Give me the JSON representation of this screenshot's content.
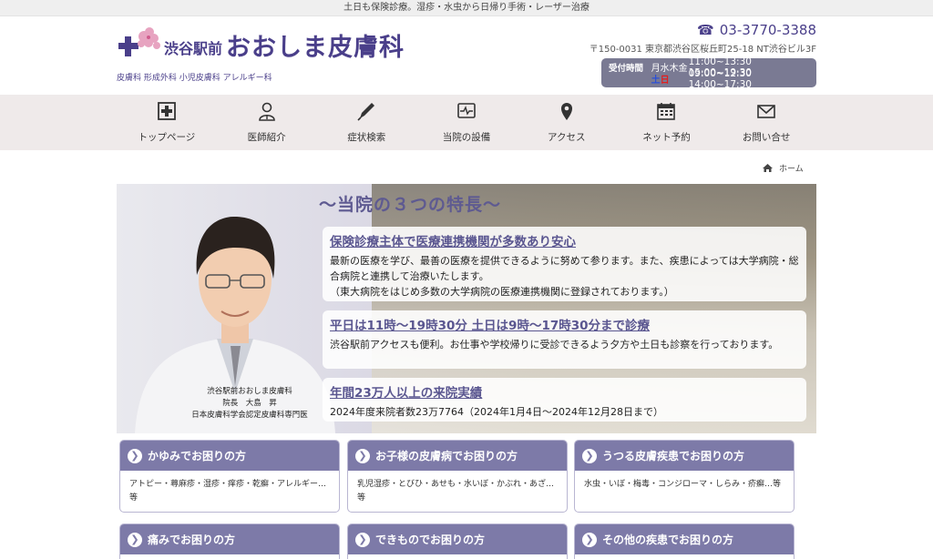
{
  "topbar": {
    "text": "土日も保険診療。湿疹・水虫から日帰り手術・レーザー治療"
  },
  "header": {
    "logo_prefix": "渋谷駅前",
    "logo_name": "おおしま皮膚科",
    "logo_subtitle": "皮膚科 形成外科 小児皮膚科 アレルギー科",
    "phone": "03-3770-3388",
    "address": "〒150-0031 東京都渋谷区桜丘町25-18 NT渋谷ビル3F",
    "hours": {
      "label": "受付時間",
      "weekdays": "月水木金",
      "weekday_times": "11:00~13:30 15:00~19:30",
      "sat": "土",
      "sun": "日",
      "weekend_times": "09:00~12:30 14:00~17:30"
    }
  },
  "nav": [
    {
      "label": "トップページ",
      "icon": "home-icon"
    },
    {
      "label": "医師紹介",
      "icon": "doctor-icon"
    },
    {
      "label": "症状検索",
      "icon": "pen-icon"
    },
    {
      "label": "当院の設備",
      "icon": "monitor-icon"
    },
    {
      "label": "アクセス",
      "icon": "map-pin-icon"
    },
    {
      "label": "ネット予約",
      "icon": "calendar-icon"
    },
    {
      "label": "お問い合せ",
      "icon": "mail-icon"
    }
  ],
  "breadcrumb": {
    "home": "ホーム"
  },
  "hero": {
    "title": "～当院の３つの特長～",
    "caption_line1": "渋谷駅前おおしま皮膚科",
    "caption_line2": "院長　大島　昇",
    "caption_line3": "日本皮膚科学会認定皮膚科専門医",
    "features": [
      {
        "title": "保険診療主体で医療連携機関が多数あり安心",
        "text": "最新の医療を学び、最善の医療を提供できるように努めて参ります。また、疾患によっては大学病院・総合病院と連携して治療いたします。\n（東大病院をはじめ多数の大学病院の医療連携機関に登録されております。）"
      },
      {
        "title": "平日は11時〜19時30分 土日は9時〜17時30分まで診療",
        "text": "渋谷駅前アクセスも便利。お仕事や学校帰りに受診できるよう夕方や土日も診察を行っております。"
      },
      {
        "title": "年間23万人以上の来院実績",
        "text": "2024年度来院者数23万7764（2024年1月4日〜2024年12月28日まで）"
      }
    ]
  },
  "cards": [
    {
      "title": "かゆみでお困りの方",
      "body": "アトピー・蕁麻疹・湿疹・痒疹・乾癬・アレルギー…等"
    },
    {
      "title": "お子様の皮膚病でお困りの方",
      "body": "乳児湿疹・とびひ・あせも・水いぼ・かぶれ・あざ…等"
    },
    {
      "title": "うつる皮膚疾患でお困りの方",
      "body": "水虫・いぼ・梅毒・コンジローマ・しらみ・疥癬…等"
    },
    {
      "title": "痛みでお困りの方",
      "body": ""
    },
    {
      "title": "できものでお困りの方",
      "body": ""
    },
    {
      "title": "その他の疾患でお困りの方",
      "body": ""
    }
  ],
  "colors": {
    "brand": "#4a3f8a",
    "card_header": "#7d7aa8",
    "nav_bg": "#efeaea",
    "hours_bg": "#7a7a93"
  }
}
